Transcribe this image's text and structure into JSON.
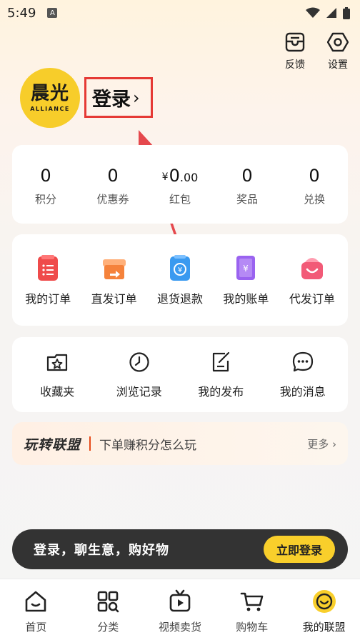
{
  "status_bar": {
    "time": "5:49",
    "notif_glyph": "A"
  },
  "top_actions": [
    {
      "label": "反馈",
      "icon": "feedback-icon"
    },
    {
      "label": "设置",
      "icon": "settings-icon"
    }
  ],
  "profile": {
    "brand_cn": "晨光",
    "brand_en": "ALLIANCE",
    "login_label": "登录",
    "login_chevron": "›"
  },
  "stats": [
    {
      "value": "0",
      "label": "积分"
    },
    {
      "value": "0",
      "label": "优惠券"
    },
    {
      "currency": "¥",
      "value": "0",
      "decimal": ".00",
      "label": "红包"
    },
    {
      "value": "0",
      "label": "奖品"
    },
    {
      "value": "0",
      "label": "兑换"
    }
  ],
  "orders": [
    {
      "label": "我的订单",
      "icon": "my-orders-icon",
      "color": "#ef4b4b"
    },
    {
      "label": "直发订单",
      "icon": "direct-orders-icon",
      "color": "#f5823b"
    },
    {
      "label": "退货退款",
      "icon": "refund-icon",
      "color": "#3a9af0"
    },
    {
      "label": "我的账单",
      "icon": "bill-icon",
      "color": "#9a63f0"
    },
    {
      "label": "代发订单",
      "icon": "dropship-orders-icon",
      "color": "#f25a77"
    }
  ],
  "tools": [
    {
      "label": "收藏夹",
      "icon": "favorites-icon"
    },
    {
      "label": "浏览记录",
      "icon": "history-icon"
    },
    {
      "label": "我的发布",
      "icon": "my-posts-icon"
    },
    {
      "label": "我的消息",
      "icon": "messages-icon"
    }
  ],
  "play_banner": {
    "title": "玩转联盟",
    "description": "下单赚积分怎么玩",
    "more": "更多 ›"
  },
  "login_banner": {
    "message": "登录，聊生意，购好物",
    "button": "立即登录"
  },
  "tabs": [
    {
      "label": "首页",
      "icon": "home-icon"
    },
    {
      "label": "分类",
      "icon": "category-icon"
    },
    {
      "label": "视频卖货",
      "icon": "video-icon"
    },
    {
      "label": "购物车",
      "icon": "cart-icon"
    },
    {
      "label": "我的联盟",
      "icon": "my-alliance-icon",
      "active": true
    }
  ],
  "colors": {
    "accent_yellow": "#f9cf2b",
    "highlight_red": "#e53935",
    "banner_dark": "#333333"
  }
}
